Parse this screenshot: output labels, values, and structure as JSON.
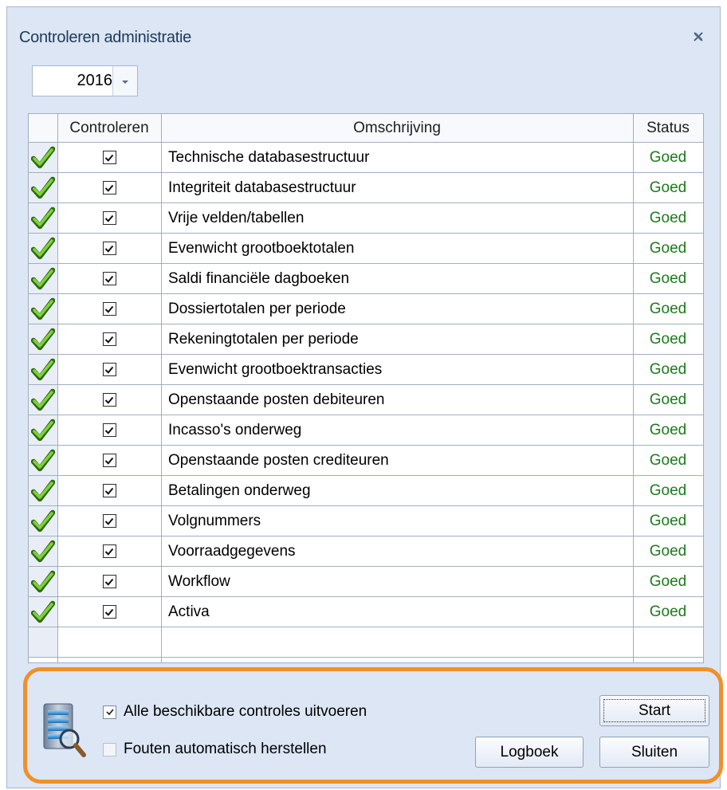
{
  "window": {
    "title": "Controleren administratie"
  },
  "year_select": {
    "value": "2016"
  },
  "grid": {
    "columns": [
      "Controleren",
      "Omschrijving",
      "Status"
    ],
    "rows": [
      {
        "checked": true,
        "description": "Technische databasestructuur",
        "status": "Goed"
      },
      {
        "checked": true,
        "description": "Integriteit databasestructuur",
        "status": "Goed"
      },
      {
        "checked": true,
        "description": "Vrije velden/tabellen",
        "status": "Goed"
      },
      {
        "checked": true,
        "description": "Evenwicht grootboektotalen",
        "status": "Goed"
      },
      {
        "checked": true,
        "description": "Saldi financiële dagboeken",
        "status": "Goed"
      },
      {
        "checked": true,
        "description": "Dossiertotalen per periode",
        "status": "Goed"
      },
      {
        "checked": true,
        "description": "Rekeningtotalen per periode",
        "status": "Goed"
      },
      {
        "checked": true,
        "description": "Evenwicht grootboektransacties",
        "status": "Goed"
      },
      {
        "checked": true,
        "description": "Openstaande posten debiteuren",
        "status": "Goed"
      },
      {
        "checked": true,
        "description": "Incasso's onderweg",
        "status": "Goed"
      },
      {
        "checked": true,
        "description": "Openstaande posten crediteuren",
        "status": "Goed"
      },
      {
        "checked": true,
        "description": "Betalingen onderweg",
        "status": "Goed"
      },
      {
        "checked": true,
        "description": "Volgnummers",
        "status": "Goed"
      },
      {
        "checked": true,
        "description": "Voorraadgegevens",
        "status": "Goed"
      },
      {
        "checked": true,
        "description": "Workflow",
        "status": "Goed"
      },
      {
        "checked": true,
        "description": "Activa",
        "status": "Goed"
      }
    ]
  },
  "options": {
    "run_all": {
      "label": "Alle beschikbare controles uitvoeren",
      "checked": true
    },
    "auto_fix": {
      "label": "Fouten automatisch herstellen",
      "checked": false,
      "disabled": true
    }
  },
  "buttons": {
    "start": "Start",
    "logbook": "Logboek",
    "close": "Sluiten"
  },
  "colors": {
    "status_good": "#1c7a1c",
    "highlight_border": "#f0902a",
    "window_bg": "#dce6f4"
  },
  "icons": {
    "row_status": "green-checkmark-icon",
    "panel": "database-search-icon",
    "close": "close-icon",
    "dropdown": "chevron-down-icon"
  }
}
